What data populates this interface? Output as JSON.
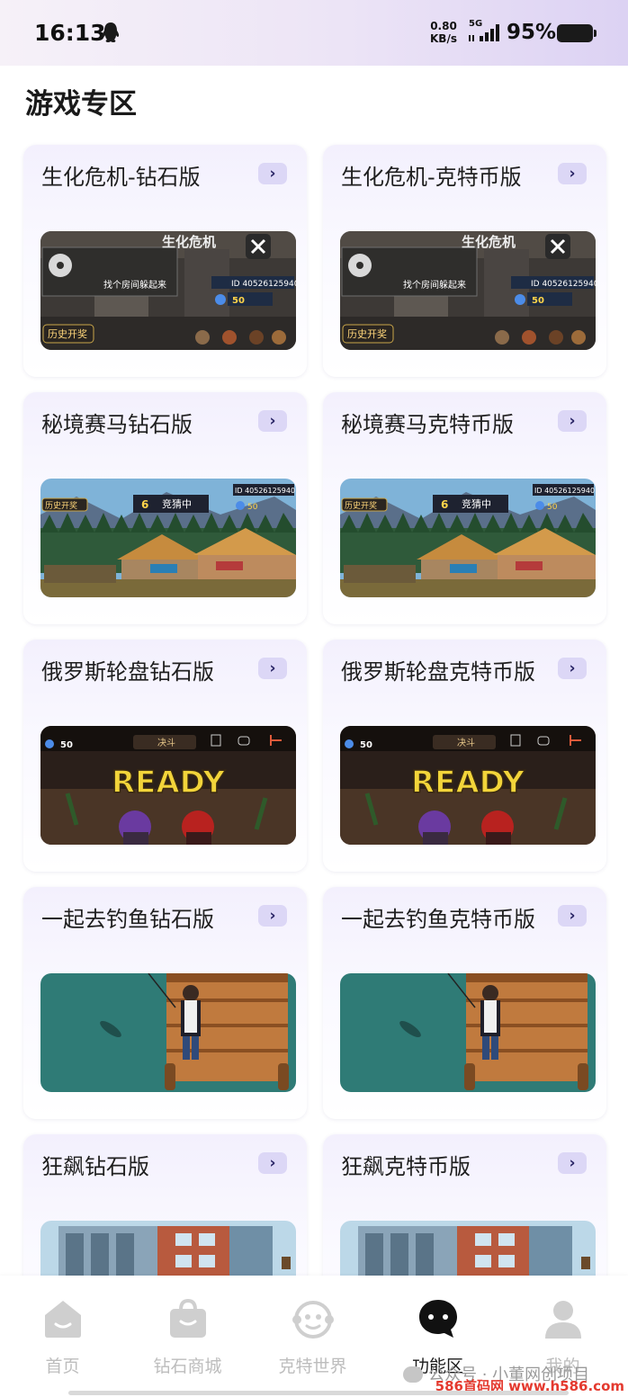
{
  "status_bar": {
    "time": "16:13",
    "net_speed_value": "0.80",
    "net_speed_unit": "KB/s",
    "network": "5G",
    "battery": "95%"
  },
  "section_title": "游戏专区",
  "cards": [
    {
      "title": "生化危机-钻石版",
      "thumb": "biohazard",
      "tag": "历史开奖",
      "hint": "找个房间躲起来",
      "game_title": "生化危机",
      "id_text": "ID 40526125940",
      "coins": "50"
    },
    {
      "title": "生化危机-克特币版",
      "thumb": "biohazard",
      "tag": "历史开奖",
      "hint": "找个房间躲起来",
      "game_title": "生化危机",
      "id_text": "ID 40526125940",
      "coins": "50"
    },
    {
      "title": "秘境赛马钻石版",
      "thumb": "horse",
      "tag": "历史开奖",
      "hint": "竞猜中",
      "round": "6",
      "id_text": "ID 40526125940",
      "coins": "50"
    },
    {
      "title": "秘境赛马克特币版",
      "thumb": "horse",
      "tag": "历史开奖",
      "hint": "竞猜中",
      "round": "6",
      "id_text": "ID 40526125940",
      "coins": "50"
    },
    {
      "title": "俄罗斯轮盘钻石版",
      "thumb": "roulette",
      "banner": "READY",
      "hint": "决斗",
      "coins": "50"
    },
    {
      "title": "俄罗斯轮盘克特币版",
      "thumb": "roulette",
      "banner": "READY",
      "hint": "决斗",
      "coins": "50"
    },
    {
      "title": "一起去钓鱼钻石版",
      "thumb": "fishing"
    },
    {
      "title": "一起去钓鱼克特币版",
      "thumb": "fishing"
    },
    {
      "title": "狂飙钻石版",
      "thumb": "city"
    },
    {
      "title": "狂飙克特币版",
      "thumb": "city"
    }
  ],
  "tabbar": {
    "tabs": [
      {
        "label": "首页",
        "icon": "home-icon",
        "active": false
      },
      {
        "label": "钻石商城",
        "icon": "shopping-bag-icon",
        "active": false
      },
      {
        "label": "克特世界",
        "icon": "monkey-face-icon",
        "active": false
      },
      {
        "label": "功能区",
        "icon": "chat-bubble-icon",
        "active": true
      },
      {
        "label": "我的",
        "icon": "person-icon",
        "active": false
      }
    ],
    "watermark": "公众号 · 小董网创项目",
    "footer_url": "586首码网 www.h586.com"
  },
  "colors": {
    "accent": "#dcd7f6",
    "arrow": "#2a2666",
    "inactive_tab": "#bdbdbd",
    "active_tab": "#1a1a1a"
  }
}
